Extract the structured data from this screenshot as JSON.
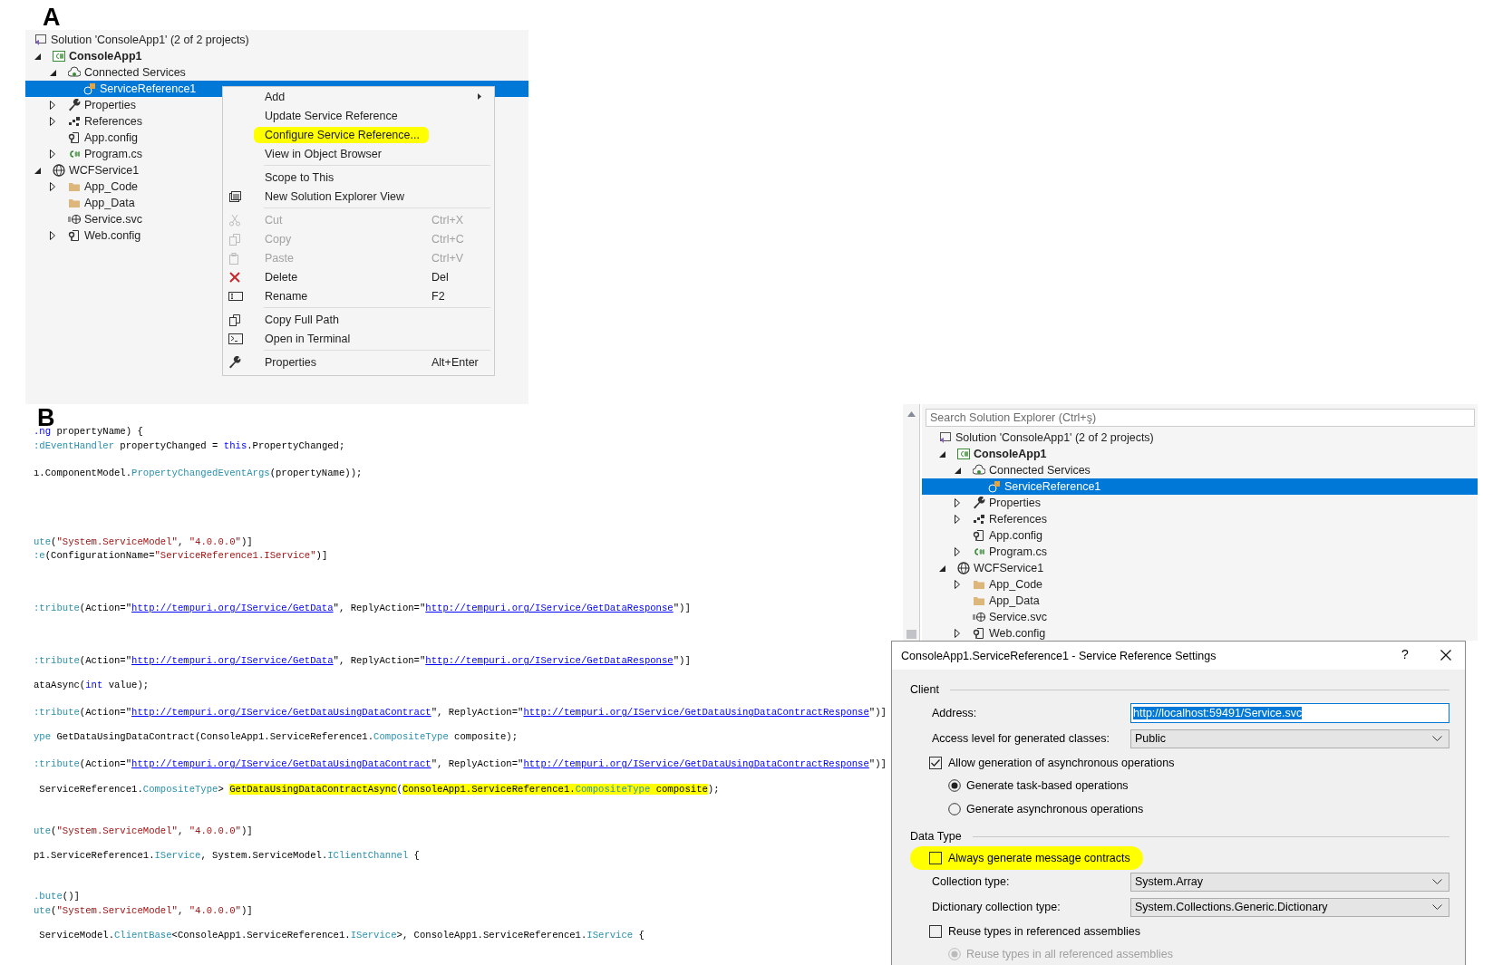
{
  "panel_a": {
    "label": "A",
    "solution": "Solution 'ConsoleApp1' (2 of 2 projects)",
    "tree": [
      {
        "label": "ConsoleApp1",
        "kind": "csharp-project",
        "startup": true,
        "expanded": true,
        "selected": false,
        "children": [
          {
            "label": "Connected Services",
            "kind": "connected",
            "expanded": true,
            "selected": false,
            "children": [
              {
                "label": "ServiceReference1",
                "kind": "service-reference",
                "selected": true
              }
            ]
          },
          {
            "label": "Properties",
            "kind": "properties",
            "expanded": false,
            "selected": false
          },
          {
            "label": "References",
            "kind": "references",
            "expanded": false,
            "selected": false
          },
          {
            "label": "App.config",
            "kind": "config",
            "selected": false
          },
          {
            "label": "Program.cs",
            "kind": "csharp-file",
            "expanded": false,
            "selected": false
          }
        ]
      },
      {
        "label": "WCFService1",
        "kind": "web-project",
        "startup": false,
        "expanded": true,
        "selected": false,
        "children": [
          {
            "label": "App_Code",
            "kind": "folder",
            "expanded": false,
            "selected": false
          },
          {
            "label": "App_Data",
            "kind": "folder",
            "selected": false
          },
          {
            "label": "Service.svc",
            "kind": "service-file",
            "selected": false
          },
          {
            "label": "Web.config",
            "kind": "config",
            "expanded": false,
            "selected": false
          }
        ]
      }
    ],
    "context_menu": {
      "groups": [
        [
          {
            "label": "Add",
            "kind": "submenu",
            "disabled": false,
            "highlighted": false
          },
          {
            "label": "Update Service Reference",
            "kind": "command",
            "disabled": false,
            "highlighted": false
          },
          {
            "label": "Configure Service Reference...",
            "kind": "command",
            "disabled": false,
            "highlighted": true
          },
          {
            "label": "View in Object Browser",
            "kind": "command",
            "disabled": false,
            "highlighted": false
          }
        ],
        [
          {
            "label": "Scope to This",
            "kind": "command",
            "disabled": false,
            "highlighted": false
          },
          {
            "label": "New Solution Explorer View",
            "kind": "window-list",
            "disabled": false,
            "highlighted": false
          }
        ],
        [
          {
            "label": "Cut",
            "kind": "cut",
            "shortcut": "Ctrl+X",
            "disabled": true,
            "highlighted": false
          },
          {
            "label": "Copy",
            "kind": "copy",
            "shortcut": "Ctrl+C",
            "disabled": true,
            "highlighted": false
          },
          {
            "label": "Paste",
            "kind": "paste",
            "shortcut": "Ctrl+V",
            "disabled": true,
            "highlighted": false
          },
          {
            "label": "Delete",
            "kind": "delete",
            "shortcut": "Del",
            "disabled": false,
            "highlighted": false
          },
          {
            "label": "Rename",
            "kind": "rename",
            "shortcut": "F2",
            "disabled": false,
            "highlighted": false
          }
        ],
        [
          {
            "label": "Copy Full Path",
            "kind": "copy",
            "disabled": false,
            "highlighted": false
          },
          {
            "label": "Open in Terminal",
            "kind": "terminal",
            "disabled": false,
            "highlighted": false
          }
        ],
        [
          {
            "label": "Properties",
            "kind": "properties",
            "shortcut": "Alt+Enter",
            "disabled": false,
            "highlighted": false
          }
        ]
      ]
    }
  },
  "panel_b": {
    "label": "B",
    "code_lines": [
      [
        {
          "kind": "keyword",
          "text": ".ng"
        },
        {
          "kind": "plain",
          "text": " propertyName) {"
        }
      ],
      [
        {
          "kind": "type",
          "text": ":dEventHandler"
        },
        {
          "kind": "plain",
          "text": " propertyChanged = "
        },
        {
          "kind": "keyword",
          "text": "this"
        },
        {
          "kind": "plain",
          "text": ".PropertyChanged;"
        }
      ],
      [
        {
          "kind": "plain",
          "text": "ı.ComponentModel."
        },
        {
          "kind": "type",
          "text": "PropertyChangedEventArgs"
        },
        {
          "kind": "plain",
          "text": "(propertyName));"
        }
      ],
      [
        {
          "kind": "type",
          "text": "ute"
        },
        {
          "kind": "plain",
          "text": "("
        },
        {
          "kind": "string",
          "text": "\"System.ServiceModel\""
        },
        {
          "kind": "plain",
          "text": ", "
        },
        {
          "kind": "string",
          "text": "\"4.0.0.0\""
        },
        {
          "kind": "plain",
          "text": ")]"
        }
      ],
      [
        {
          "kind": "type",
          "text": ":e"
        },
        {
          "kind": "plain",
          "text": "(ConfigurationName="
        },
        {
          "kind": "string",
          "text": "\"ServiceReference1.IService\""
        },
        {
          "kind": "plain",
          "text": ")]"
        }
      ],
      [
        {
          "kind": "type",
          "text": ":tribute"
        },
        {
          "kind": "plain",
          "text": "(Action=\""
        },
        {
          "kind": "link",
          "text": "http://tempuri.org/IService/GetData"
        },
        {
          "kind": "plain",
          "text": "\", ReplyAction=\""
        },
        {
          "kind": "link",
          "text": "http://tempuri.org/IService/GetDataResponse"
        },
        {
          "kind": "plain",
          "text": "\")]"
        }
      ],
      [
        {
          "kind": "type",
          "text": ":tribute"
        },
        {
          "kind": "plain",
          "text": "(Action=\""
        },
        {
          "kind": "link",
          "text": "http://tempuri.org/IService/GetData"
        },
        {
          "kind": "plain",
          "text": "\", ReplyAction=\""
        },
        {
          "kind": "link",
          "text": "http://tempuri.org/IService/GetDataResponse"
        },
        {
          "kind": "plain",
          "text": "\")]"
        }
      ],
      [
        {
          "kind": "plain",
          "text": "ataAsync("
        },
        {
          "kind": "keyword",
          "text": "int"
        },
        {
          "kind": "plain",
          "text": " value);"
        }
      ],
      [
        {
          "kind": "type",
          "text": ":tribute"
        },
        {
          "kind": "plain",
          "text": "(Action=\""
        },
        {
          "kind": "link",
          "text": "http://tempuri.org/IService/GetDataUsingDataContract"
        },
        {
          "kind": "plain",
          "text": "\", ReplyAction=\""
        },
        {
          "kind": "link",
          "text": "http://tempuri.org/IService/GetDataUsingDataContractResponse"
        },
        {
          "kind": "plain",
          "text": "\")]"
        }
      ],
      [
        {
          "kind": "type",
          "text": "ype"
        },
        {
          "kind": "plain",
          "text": " GetDataUsingDataContract(ConsoleApp1.ServiceReference1."
        },
        {
          "kind": "type",
          "text": "CompositeType"
        },
        {
          "kind": "plain",
          "text": " composite);"
        }
      ],
      [
        {
          "kind": "type",
          "text": ":tribute"
        },
        {
          "kind": "plain",
          "text": "(Action=\""
        },
        {
          "kind": "link",
          "text": "http://tempuri.org/IService/GetDataUsingDataContract"
        },
        {
          "kind": "plain",
          "text": "\", ReplyAction=\""
        },
        {
          "kind": "link",
          "text": "http://tempuri.org/IService/GetDataUsingDataContractResponse"
        },
        {
          "kind": "plain",
          "text": "\")]"
        }
      ],
      [
        {
          "kind": "plain",
          "text": " ServiceReference1.",
          "highlighted": false
        },
        {
          "kind": "type",
          "text": "CompositeType",
          "highlighted": false
        },
        {
          "kind": "plain",
          "text": "> ",
          "highlighted": false
        },
        {
          "kind": "plain",
          "text": "GetDataUsingDataContractAsync",
          "highlighted": true
        },
        {
          "kind": "plain",
          "text": "(",
          "highlighted": false
        },
        {
          "kind": "plain",
          "text": "ConsoleApp1.ServiceReference1.",
          "highlighted": true
        },
        {
          "kind": "type",
          "text": "CompositeType",
          "highlighted": true
        },
        {
          "kind": "plain",
          "text": " composite",
          "highlighted": true
        },
        {
          "kind": "plain",
          "text": ");",
          "highlighted": false
        }
      ],
      [
        {
          "kind": "type",
          "text": "ute"
        },
        {
          "kind": "plain",
          "text": "("
        },
        {
          "kind": "string",
          "text": "\"System.ServiceModel\""
        },
        {
          "kind": "plain",
          "text": ", "
        },
        {
          "kind": "string",
          "text": "\"4.0.0.0\""
        },
        {
          "kind": "plain",
          "text": ")]"
        }
      ],
      [
        {
          "kind": "plain",
          "text": "p1.ServiceReference1."
        },
        {
          "kind": "type",
          "text": "IService"
        },
        {
          "kind": "plain",
          "text": ", System.ServiceModel."
        },
        {
          "kind": "type",
          "text": "IClientChannel"
        },
        {
          "kind": "plain",
          "text": " {"
        }
      ],
      [
        {
          "kind": "type",
          "text": ".bute"
        },
        {
          "kind": "plain",
          "text": "()]"
        }
      ],
      [
        {
          "kind": "type",
          "text": "ute"
        },
        {
          "kind": "plain",
          "text": "("
        },
        {
          "kind": "string",
          "text": "\"System.ServiceModel\""
        },
        {
          "kind": "plain",
          "text": ", "
        },
        {
          "kind": "string",
          "text": "\"4.0.0.0\""
        },
        {
          "kind": "plain",
          "text": ")]"
        }
      ],
      [
        {
          "kind": "plain",
          "text": " ServiceModel."
        },
        {
          "kind": "type",
          "text": "ClientBase"
        },
        {
          "kind": "plain",
          "text": "<ConsoleApp1.ServiceReference1."
        },
        {
          "kind": "type",
          "text": "IService"
        },
        {
          "kind": "plain",
          "text": ">, ConsoleApp1.ServiceReference1."
        },
        {
          "kind": "type",
          "text": "IService"
        },
        {
          "kind": "plain",
          "text": " {"
        }
      ]
    ]
  },
  "solution_explorer": {
    "search": {
      "placeholder": "Search Solution Explorer (Ctrl+ş)"
    },
    "solution": "Solution 'ConsoleApp1' (2 of 2 projects)",
    "tree": [
      {
        "label": "ConsoleApp1",
        "kind": "csharp-project",
        "startup": true,
        "expanded": true,
        "selected": false,
        "children": [
          {
            "label": "Connected Services",
            "kind": "connected",
            "expanded": true,
            "selected": false,
            "children": [
              {
                "label": "ServiceReference1",
                "kind": "service-reference",
                "selected": true
              }
            ]
          },
          {
            "label": "Properties",
            "kind": "properties",
            "expanded": false,
            "selected": false
          },
          {
            "label": "References",
            "kind": "references",
            "expanded": false,
            "selected": false
          },
          {
            "label": "App.config",
            "kind": "config",
            "selected": false
          },
          {
            "label": "Program.cs",
            "kind": "csharp-file",
            "expanded": false,
            "selected": false
          }
        ]
      },
      {
        "label": "WCFService1",
        "kind": "web-project",
        "startup": false,
        "expanded": true,
        "selected": false,
        "children": [
          {
            "label": "App_Code",
            "kind": "folder",
            "expanded": false,
            "selected": false
          },
          {
            "label": "App_Data",
            "kind": "folder",
            "selected": false
          },
          {
            "label": "Service.svc",
            "kind": "service-file",
            "selected": false
          },
          {
            "label": "Web.config",
            "kind": "config",
            "expanded": false,
            "selected": false
          }
        ]
      }
    ]
  },
  "dialog": {
    "title": "ConsoleApp1.ServiceReference1 - Service Reference Settings",
    "help": "?",
    "sections": [
      {
        "title": "Client",
        "rows": [
          {
            "kind": "text-field",
            "label": "Address:",
            "value": "http://localhost:59491/Service.svc",
            "text_selected": true
          },
          {
            "kind": "dropdown",
            "label": "Access level for generated classes:",
            "value": "Public"
          },
          {
            "kind": "checkbox",
            "label": "Allow generation of asynchronous operations",
            "checked": true,
            "highlighted": false
          },
          {
            "kind": "radio",
            "label": "Generate task-based operations",
            "selected": true,
            "disabled": false
          },
          {
            "kind": "radio",
            "label": "Generate asynchronous operations",
            "selected": false,
            "disabled": false
          }
        ]
      },
      {
        "title": "Data Type",
        "rows": [
          {
            "kind": "checkbox",
            "label": "Always generate message contracts",
            "checked": false,
            "highlighted": true
          },
          {
            "kind": "dropdown",
            "label": "Collection type:",
            "value": "System.Array"
          },
          {
            "kind": "dropdown",
            "label": "Dictionary collection type:",
            "value": "System.Collections.Generic.Dictionary"
          },
          {
            "kind": "checkbox",
            "label": "Reuse types in referenced assemblies",
            "checked": false,
            "highlighted": false
          },
          {
            "kind": "radio",
            "label": "Reuse types in all referenced assemblies",
            "selected": true,
            "disabled": true
          }
        ]
      }
    ]
  }
}
